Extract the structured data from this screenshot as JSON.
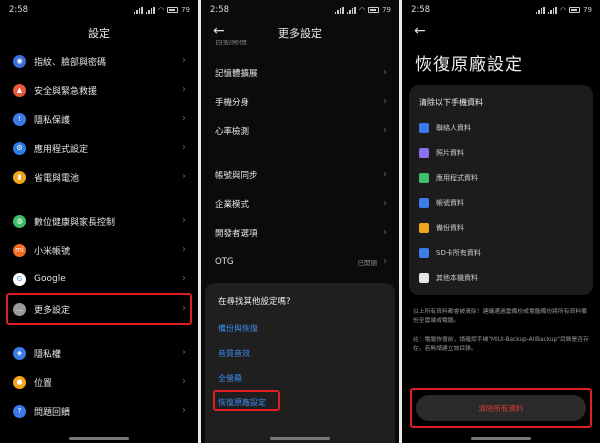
{
  "status": {
    "time": "2:58",
    "battery": "79"
  },
  "screen1": {
    "title": "設定",
    "items": [
      {
        "label": "指紋、臉部與密碼",
        "icon": "fingerprint-icon",
        "color": "#3a6fd8"
      },
      {
        "label": "安全與緊急救援",
        "icon": "emergency-icon",
        "color": "#e8583a"
      },
      {
        "label": "隱私保護",
        "icon": "privacy-icon",
        "color": "#3a7be8"
      },
      {
        "label": "應用程式設定",
        "icon": "app-settings-icon",
        "color": "#2f7ee8"
      },
      {
        "label": "省電與電池",
        "icon": "battery-icon",
        "color": "#f2a51c"
      },
      {
        "label": "數位健康與家長控制",
        "icon": "wellbeing-icon",
        "color": "#3dbf6a"
      },
      {
        "label": "小米帳號",
        "icon": "mi-account-icon",
        "color": "#f26a1b"
      },
      {
        "label": "Google",
        "icon": "google-icon",
        "color": "#ffffff"
      },
      {
        "label": "更多設定",
        "icon": "more-settings-icon",
        "color": "#9a9a9a"
      },
      {
        "label": "隱私權",
        "icon": "privacy-permission-icon",
        "color": "#3a7be8"
      },
      {
        "label": "位置",
        "icon": "location-icon",
        "color": "#f2a51c"
      },
      {
        "label": "問題回饋",
        "icon": "feedback-icon",
        "color": "#3a7be8"
      }
    ]
  },
  "screen2": {
    "title": "更多設定",
    "top_partial": "自動開機",
    "items": [
      {
        "label": "記憶體擴展"
      },
      {
        "label": "手機分身"
      },
      {
        "label": "心率檢測"
      },
      {
        "label": "帳號與同步"
      },
      {
        "label": "企業模式"
      },
      {
        "label": "開發者選項"
      },
      {
        "label": "OTG",
        "value": "已開閉"
      }
    ],
    "popup": {
      "title": "在尋找其他設定嗎?",
      "links": [
        "備份與恢復",
        "音質音效",
        "全螢幕",
        "恢復原廠設定"
      ]
    }
  },
  "screen3": {
    "title": "恢復原廠設定",
    "card_title": "清除以下手機資料",
    "items": [
      {
        "label": "聯絡人資料",
        "color": "#3a7be8"
      },
      {
        "label": "照片資料",
        "color": "#8a6ff0"
      },
      {
        "label": "應用程式資料",
        "color": "#3dbf6a"
      },
      {
        "label": "帳號資料",
        "color": "#3a7be8"
      },
      {
        "label": "備份資料",
        "color": "#f2a51c"
      },
      {
        "label": "SD卡所有資料",
        "color": "#3a7be8"
      },
      {
        "label": "其他本機資料",
        "color": "#e6e6e6"
      }
    ],
    "note1": "以上所有資料都會被清除！建議通過雲備份或電腦備份將所有資料備份至雲端或電腦。",
    "note2": "註：電腦恢復前，請確認手機\"MIUI-Backup-AllBackup\"目錄是否存在，若無請建立該目錄。",
    "button": "清除所有資料"
  }
}
